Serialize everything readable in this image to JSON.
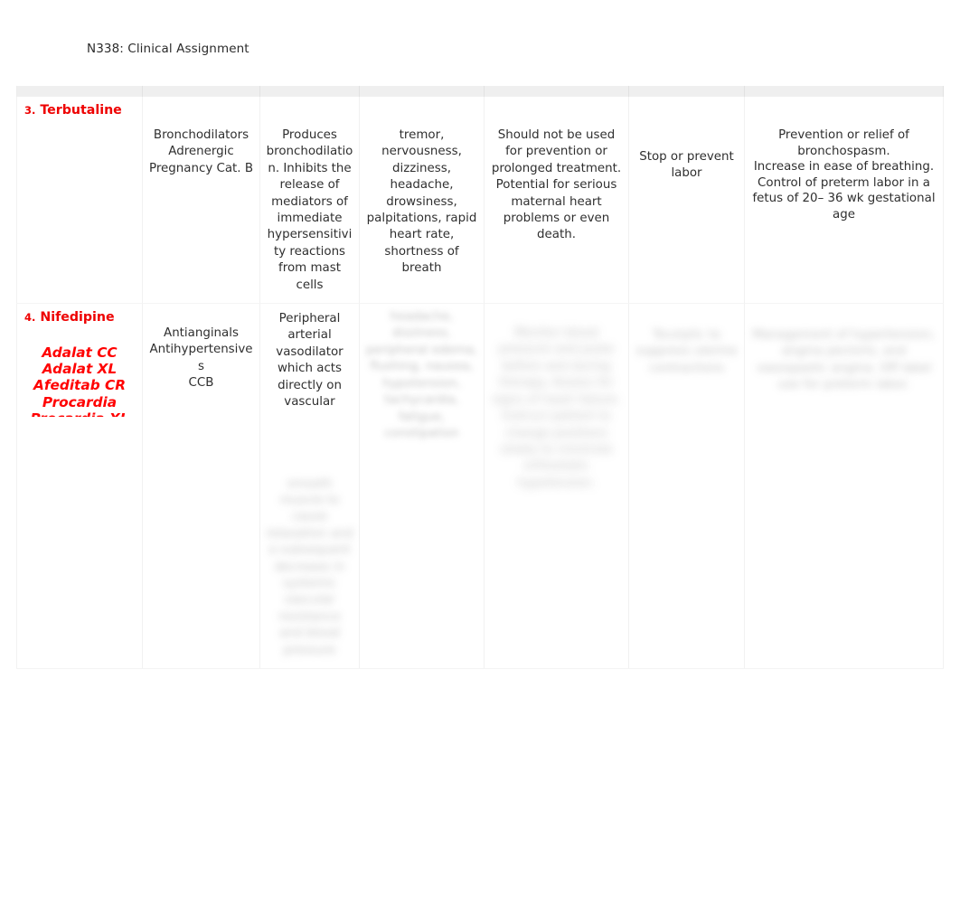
{
  "document": {
    "header": "N338: Clinical Assignment"
  },
  "table": {
    "colors": {
      "drug_name": "#ee0000",
      "brand_name": "#ff0000",
      "body_text": "#2f2f2f",
      "header_strip": "#efefef"
    },
    "rows": [
      {
        "number": "3.",
        "drug": "Terbutaline",
        "brands": [],
        "classification": "Bronchodilators\nAdrenergic\nPregnancy Cat. B",
        "action": "Produces bronchodilation.  Inhibits the release of mediators of immediate hypersensitivity reactions from mast cells",
        "side_effects": "tremor, nervousness, dizziness, headache, drowsiness, palpitations, rapid heart rate, shortness of breath",
        "nursing_considerations": "Should not be used for prevention or prolonged treatment. Potential for serious maternal heart problems or even death.",
        "purpose": "Stop or prevent labor",
        "indications": "Prevention or relief of bronchospasm.\nIncrease in ease of breathing.\nControl of preterm labor in a fetus of 20– 36 wk gestational age",
        "blurred": false
      },
      {
        "number": "4.",
        "drug": "Nifedipine",
        "brands": [
          "Adalat CC",
          "Adalat XL",
          "Afeditab CR",
          "Procardia",
          "Procardia XL"
        ],
        "classification": "Antianginals\nAntihypertensives\nCCB",
        "action": "Peripheral arterial vasodilator which acts directly on vascular",
        "action_blurred": "smooth muscle to cause relaxation and a subsequent decrease in systemic vascular resistance and blood pressure",
        "side_effects_blurred": "headache, dizziness, peripheral edema, flushing, nausea, hypotension, tachycardia, fatigue, constipation",
        "nursing_considerations_blurred": "Monitor blood pressure and pulse before and during therapy. Assess for signs of heart failure. Instruct patient to change positions slowly to minimize orthostatic hypotension.",
        "purpose_blurred": "Tocolytic to suppress uterine contractions",
        "indications_blurred": "Management of hypertension, angina pectoris, and vasospastic angina. Off label use for preterm labor.",
        "blurred": true
      }
    ]
  }
}
